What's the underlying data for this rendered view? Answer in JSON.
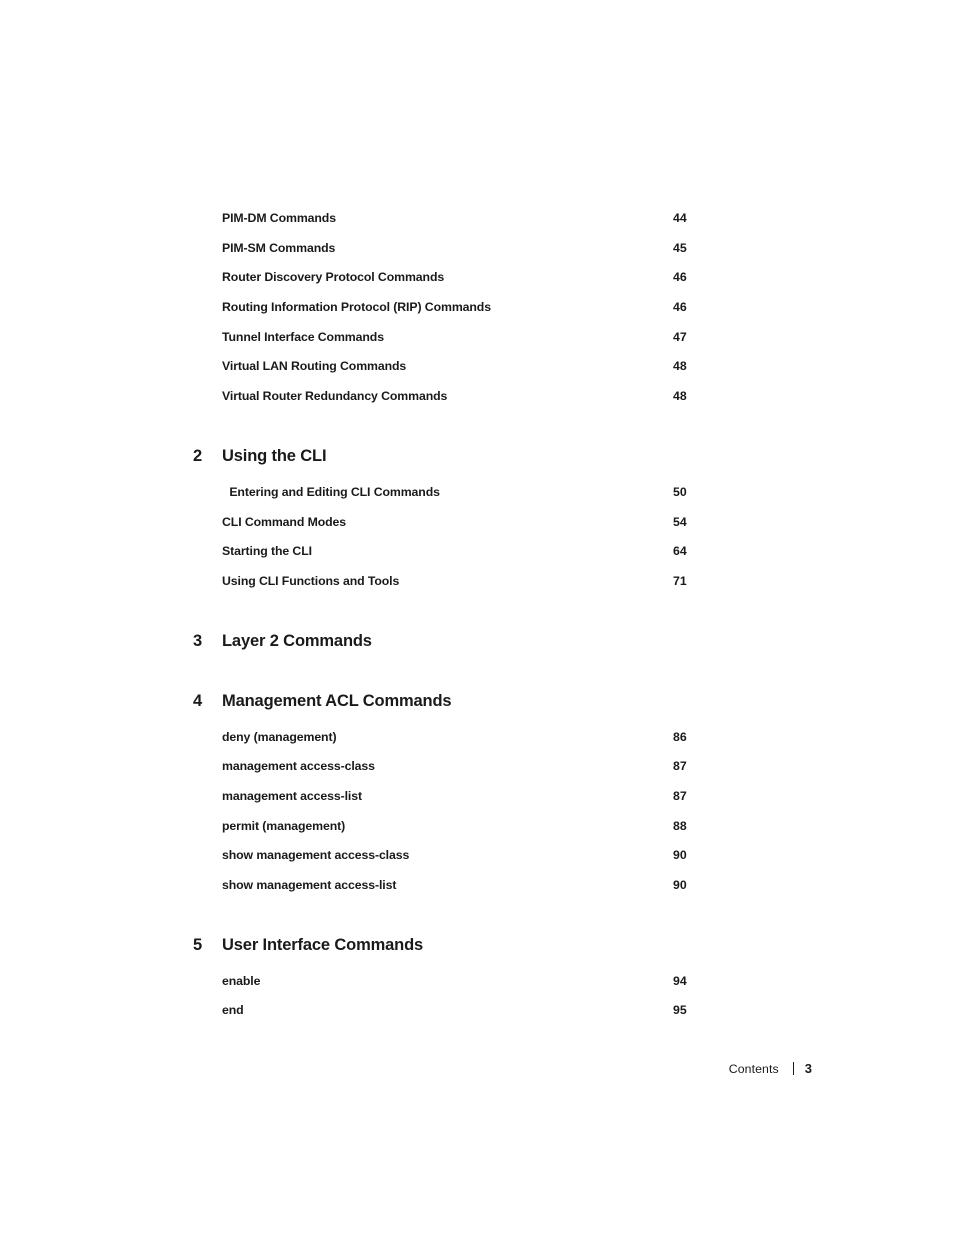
{
  "page": {
    "footer_label": "Contents",
    "footer_separator": "|",
    "footer_page_number": "3"
  },
  "toc": {
    "entries_top": [
      {
        "label": "PIM-DM Commands",
        "page": "44"
      },
      {
        "label": "PIM-SM Commands",
        "page": "45"
      },
      {
        "label": "Router Discovery Protocol Commands",
        "page": "46"
      },
      {
        "label": "Routing Information Protocol (RIP) Commands",
        "page": "46"
      },
      {
        "label": "Tunnel Interface Commands",
        "page": "47"
      },
      {
        "label": "Virtual LAN Routing Commands",
        "page": "48"
      },
      {
        "label": "Virtual Router Redundancy Commands",
        "page": "48"
      }
    ],
    "chapters": [
      {
        "number": "2",
        "title": "Using the CLI",
        "entries": [
          {
            "label": " Entering and Editing CLI Commands",
            "page": "50"
          },
          {
            "label": "CLI Command Modes",
            "page": "54"
          },
          {
            "label": "Starting the CLI",
            "page": "64"
          },
          {
            "label": "Using CLI Functions and Tools",
            "page": "71"
          }
        ]
      },
      {
        "number": "3",
        "title": "Layer 2 Commands",
        "entries": []
      },
      {
        "number": "4",
        "title": "Management ACL Commands",
        "entries": [
          {
            "label": "deny (management)",
            "page": "86"
          },
          {
            "label": "management access-class",
            "page": "87"
          },
          {
            "label": "management access-list",
            "page": "87"
          },
          {
            "label": "permit (management)",
            "page": "88"
          },
          {
            "label": "show management access-class",
            "page": "90"
          },
          {
            "label": "show management access-list",
            "page": "90"
          }
        ]
      },
      {
        "number": "5",
        "title": "User Interface Commands",
        "entries": [
          {
            "label": "enable",
            "page": "94"
          },
          {
            "label": "end",
            "page": "95"
          }
        ]
      }
    ]
  }
}
